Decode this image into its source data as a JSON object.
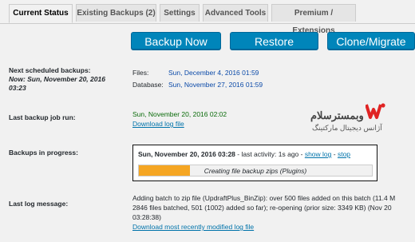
{
  "tabs": [
    {
      "label": "Current Status",
      "active": true
    },
    {
      "label": "Existing Backups (2)",
      "active": false
    },
    {
      "label": "Settings",
      "active": false
    },
    {
      "label": "Advanced Tools",
      "active": false
    },
    {
      "label": "Premium / Extensions",
      "active": false
    }
  ],
  "actions": {
    "backup_now": "Backup Now",
    "restore": "Restore",
    "clone_migrate": "Clone/Migrate"
  },
  "scheduled": {
    "label": "Next scheduled backups:",
    "now": "Now: Sun, November 20, 2016 03:23",
    "files_label": "Files:",
    "files_value": "Sun, December 4, 2016 01:59",
    "database_label": "Database:",
    "database_value": "Sun, November 27, 2016 01:59"
  },
  "last_job": {
    "label": "Last backup job run:",
    "value": "Sun, November 20, 2016 02:02",
    "download_log": "Download log file"
  },
  "in_progress": {
    "label": "Backups in progress:",
    "date": "Sun, November 20, 2016 03:28",
    "activity": " - last activity: 1s ago - ",
    "show_log": "show log",
    "separator": " - ",
    "stop": "stop",
    "progress_text": "Creating file backup zips (Plugins)",
    "progress_fraction": 0.22
  },
  "last_log": {
    "label": "Last log message:",
    "line1": "Adding batch to zip file (UpdraftPlus_BinZip): over 500 files added on this batch (11.4 M",
    "line2": "2846 files batched, 501 (1002) added so far); re-opening (prior size: 3349 KB) (Nov 20",
    "line3": "03:28:38)",
    "download": "Download most recently modified log file"
  },
  "watermark": {
    "brand": "وبمسترسلام",
    "tagline": "آژانس دیجیتال مارکتینگ",
    "color": "#e02424"
  }
}
